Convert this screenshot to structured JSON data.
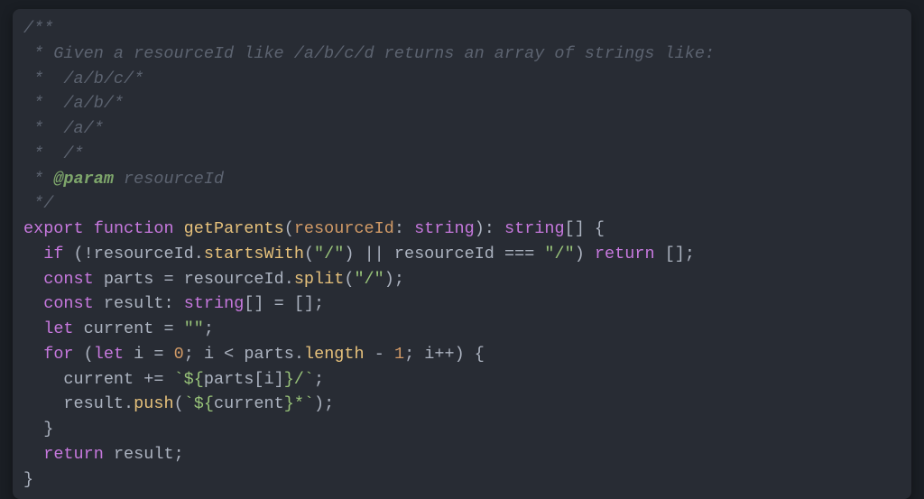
{
  "code": {
    "lines": [
      {
        "type": "comment",
        "segments": [
          "/**"
        ]
      },
      {
        "type": "comment",
        "segments": [
          " * Given a resourceId like /a/b/c/d returns an array of strings like:"
        ]
      },
      {
        "type": "comment",
        "segments": [
          " *  /a/b/c/*"
        ]
      },
      {
        "type": "comment",
        "segments": [
          " *  /a/b/*"
        ]
      },
      {
        "type": "comment",
        "segments": [
          " *  /a/*"
        ]
      },
      {
        "type": "comment",
        "segments": [
          " *  /*"
        ]
      },
      {
        "type": "docparam",
        "tag": "@param",
        "name": "resourceId"
      },
      {
        "type": "comment",
        "segments": [
          " */"
        ]
      },
      {
        "type": "fnDecl",
        "export": "export",
        "function": "function",
        "name": "getParents",
        "param": "resourceId",
        "paramType": "string",
        "retType": "string",
        "brackets": "[]"
      },
      {
        "type": "ifLine"
      },
      {
        "type": "constSplit"
      },
      {
        "type": "constResult"
      },
      {
        "type": "letCurrent"
      },
      {
        "type": "forLine"
      },
      {
        "type": "currentAppend"
      },
      {
        "type": "resultPush"
      },
      {
        "type": "closeBrace1"
      },
      {
        "type": "returnLine"
      },
      {
        "type": "closeBrace2"
      }
    ],
    "tokens": {
      "export": "export",
      "function": "function",
      "getParents": "getParents",
      "resourceId": "resourceId",
      "string": "string",
      "if": "if",
      "startsWith": "startsWith",
      "slash": "\"/\"",
      "return": "return",
      "emptyArr": "[]",
      "const": "const",
      "parts": "parts",
      "split": "split",
      "result": "result",
      "let": "let",
      "current": "current",
      "emptyStr": "\"\"",
      "for": "for",
      "i": "i",
      "zero": "0",
      "length": "length",
      "one": "1",
      "push": "push",
      "tplOpen": "`${",
      "tplMid1": "parts[i]}/`",
      "tplMid2": "current}*`",
      "closeBrace": "}",
      "returnResult": "result",
      "docPrefix": " * ",
      "docTag": "@param",
      "docName": " resourceId"
    }
  }
}
